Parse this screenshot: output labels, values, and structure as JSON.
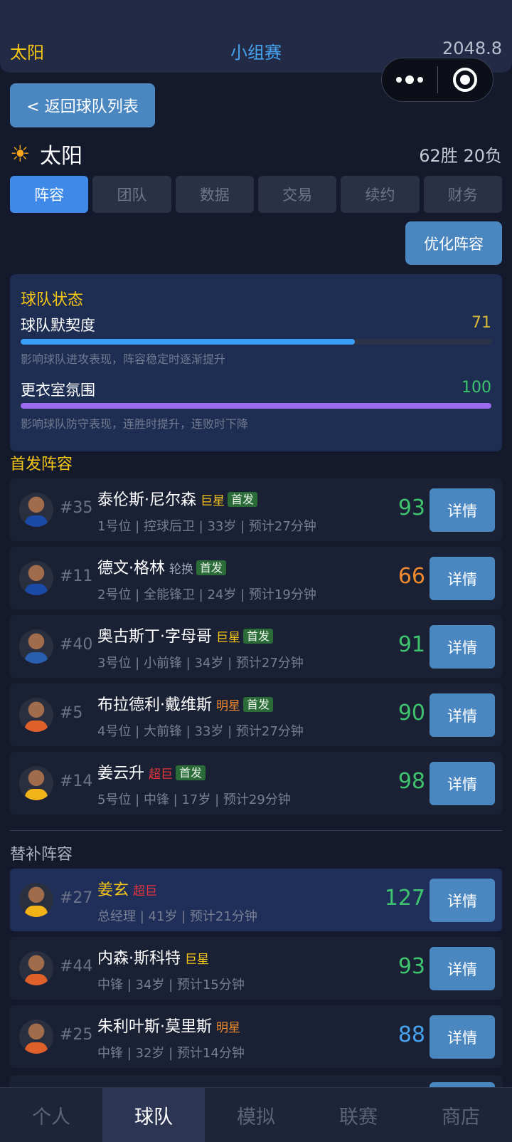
{
  "header": {
    "team": "太阳",
    "stage": "小组赛",
    "money": "2048.8"
  },
  "back_label": "< 返回球队列表",
  "team": {
    "name": "太阳",
    "record": "62胜 20负",
    "icon": "sun-icon"
  },
  "tabs": [
    {
      "label": "阵容",
      "active": true
    },
    {
      "label": "团队",
      "active": false
    },
    {
      "label": "数据",
      "active": false
    },
    {
      "label": "交易",
      "active": false
    },
    {
      "label": "续约",
      "active": false
    },
    {
      "label": "财务",
      "active": false
    }
  ],
  "optimize_label": "优化阵容",
  "status": {
    "title": "球队状态",
    "chemistry": {
      "label": "球队默契度",
      "value": "71",
      "desc": "影响球队进攻表现，阵容稳定时逐渐提升",
      "fill": 0.71
    },
    "morale": {
      "label": "更衣室氛围",
      "value": "100",
      "desc": "影响球队防守表现，连胜时提升，连败时下降",
      "fill": 1.0
    }
  },
  "starters_title": "首发阵容",
  "bench_title": "替补阵容",
  "detail_label": "详情",
  "colors": {
    "gold": "#f5c518",
    "green": "#3ec46d",
    "orange": "#f08a2c",
    "blue": "#47a3f0",
    "red": "#e8343a"
  },
  "starters": [
    {
      "num": "#35",
      "name": "泰伦斯·尼尔森",
      "tier": "巨星",
      "tier_color": "#f5c518",
      "badge": "首发",
      "info": "1号位 | 控球后卫 | 33岁 | 预计27分钟",
      "rating": "93",
      "rating_color": "#3ec46d",
      "jersey": "#1c4aa8"
    },
    {
      "num": "#11",
      "name": "德文·格林",
      "tier": "轮换",
      "tier_color": "#9aa1b2",
      "badge": "首发",
      "info": "2号位 | 全能锋卫 | 24岁 | 预计19分钟",
      "rating": "66",
      "rating_color": "#f08a2c",
      "jersey": "#1c4aa8"
    },
    {
      "num": "#40",
      "name": "奥古斯丁·字母哥",
      "tier": "巨星",
      "tier_color": "#f5c518",
      "badge": "首发",
      "info": "3号位 | 小前锋 | 34岁 | 预计27分钟",
      "rating": "91",
      "rating_color": "#3ec46d",
      "jersey": "#2a5fb0"
    },
    {
      "num": "#5",
      "name": "布拉德利·戴维斯",
      "tier": "明星",
      "tier_color": "#f08a2c",
      "badge": "首发",
      "info": "4号位 | 大前锋 | 33岁 | 预计27分钟",
      "rating": "90",
      "rating_color": "#3ec46d",
      "jersey": "#e0602a"
    },
    {
      "num": "#14",
      "name": "姜云升",
      "tier": "超巨",
      "tier_color": "#e8343a",
      "badge": "首发",
      "info": "5号位 | 中锋 | 17岁 | 预计29分钟",
      "rating": "98",
      "rating_color": "#3ec46d",
      "jersey": "#f2b319"
    }
  ],
  "bench": [
    {
      "num": "#27",
      "name": "姜玄",
      "name_color": "#f5c518",
      "tier": "超巨",
      "tier_color": "#e8343a",
      "info": "总经理 | 41岁 | 预计21分钟",
      "rating": "127",
      "rating_color": "#3ec46d",
      "jersey": "#f2b319",
      "highlight": true
    },
    {
      "num": "#44",
      "name": "内森·斯科特",
      "tier": "巨星",
      "tier_color": "#f5c518",
      "info": "中锋 | 34岁 | 预计15分钟",
      "rating": "93",
      "rating_color": "#3ec46d",
      "jersey": "#e0602a"
    },
    {
      "num": "#25",
      "name": "朱利叶斯·莫里斯",
      "tier": "明星",
      "tier_color": "#f08a2c",
      "info": "中锋 | 32岁 | 预计14分钟",
      "rating": "88",
      "rating_color": "#47a3f0",
      "jersey": "#e0602a"
    }
  ],
  "nav": [
    {
      "label": "个人",
      "active": false
    },
    {
      "label": "球队",
      "active": true
    },
    {
      "label": "模拟",
      "active": false
    },
    {
      "label": "联赛",
      "active": false
    },
    {
      "label": "商店",
      "active": false
    }
  ]
}
